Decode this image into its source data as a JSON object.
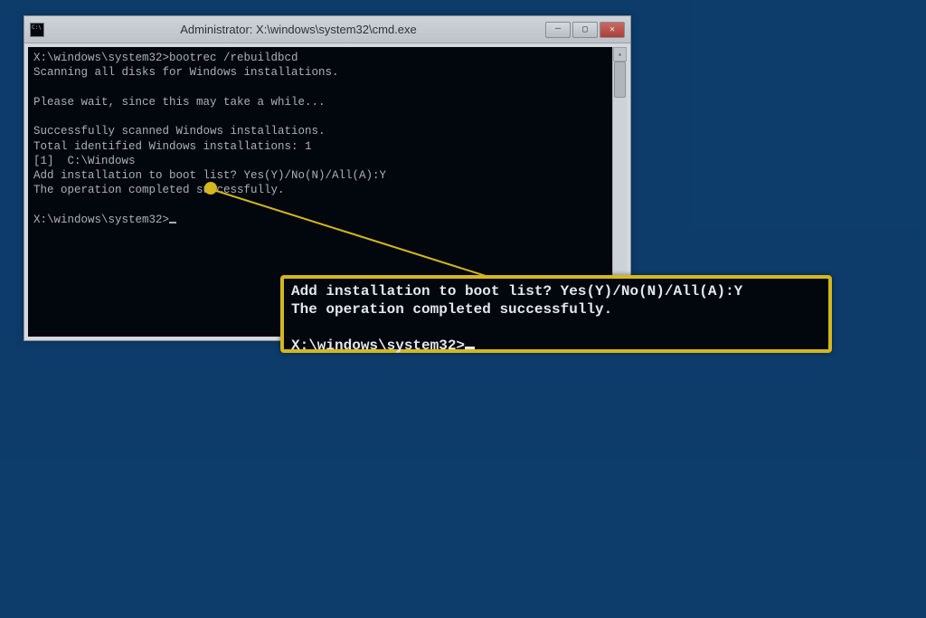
{
  "window": {
    "title": "Administrator: X:\\windows\\system32\\cmd.exe",
    "controls": {
      "minimize": "—",
      "maximize": "▢",
      "close": "✕"
    }
  },
  "console": {
    "line1": "X:\\windows\\system32>bootrec /rebuildbcd",
    "line2": "Scanning all disks for Windows installations.",
    "line3": "",
    "line4": "Please wait, since this may take a while...",
    "line5": "",
    "line6": "Successfully scanned Windows installations.",
    "line7": "Total identified Windows installations: 1",
    "line8": "[1]  C:\\Windows",
    "line9": "Add installation to boot list? Yes(Y)/No(N)/All(A):Y",
    "line10": "The operation completed successfully.",
    "line11": "",
    "line12": "X:\\windows\\system32>"
  },
  "zoom": {
    "line1": "Add installation to boot list? Yes(Y)/No(N)/All(A):Y",
    "line2": "The operation completed successfully.",
    "line3": "",
    "line4": "X:\\windows\\system32>"
  }
}
